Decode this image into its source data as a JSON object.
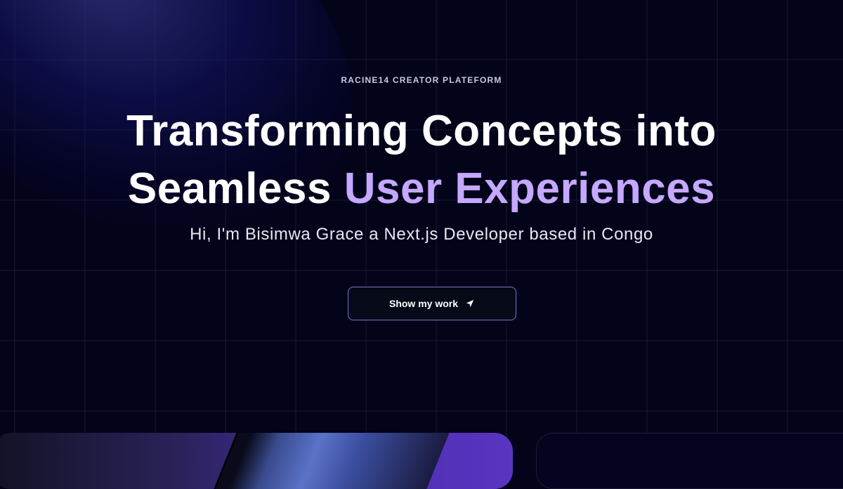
{
  "hero": {
    "eyebrow": "RACINE14 CREATOR PLATEFORM",
    "headline_line1": "Transforming Concepts into",
    "headline_line2_plain": "Seamless ",
    "headline_line2_accent": "User Experiences",
    "subtitle": "Hi, I'm Bisimwa Grace a Next.js Developer based in Congo",
    "cta_label": "Show my work",
    "cta_icon": "navigation-arrow-icon"
  },
  "colors": {
    "background": "#03031a",
    "accent": "#c5a8ff",
    "button_border": "#7b73d8"
  }
}
